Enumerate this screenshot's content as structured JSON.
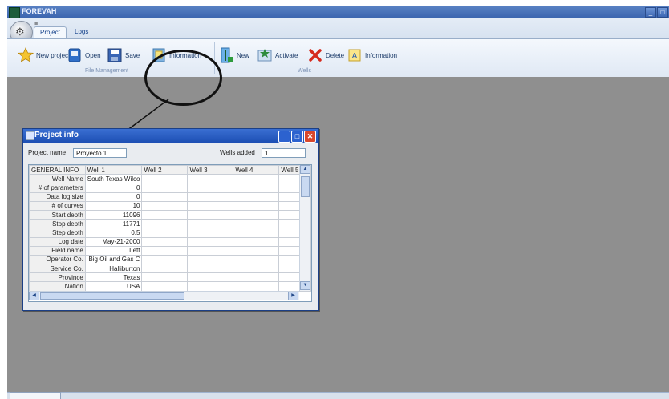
{
  "window": {
    "title": "FOREVAH"
  },
  "ribbon": {
    "quick_access": "≡",
    "tabs": [
      {
        "label": "Project"
      },
      {
        "label": "Logs"
      }
    ],
    "file_management": {
      "label": "File Management",
      "buttons": [
        {
          "label": "New project"
        },
        {
          "label": "Open"
        },
        {
          "label": "Save"
        },
        {
          "label": "Information"
        }
      ]
    },
    "wells": {
      "label": "Wells",
      "buttons": [
        {
          "label": "New"
        },
        {
          "label": "Activate"
        },
        {
          "label": "Delete"
        },
        {
          "label": "Information"
        }
      ]
    }
  },
  "dialog": {
    "title": "Project info",
    "project_name_label": "Project name",
    "project_name_value": "Proyecto 1",
    "wells_added_label": "Wells added",
    "wells_added_value": "1",
    "grid": {
      "columns": [
        "GENERAL INFO",
        "Well 1",
        "Well 2",
        "Well 3",
        "Well 4",
        "Well 5"
      ],
      "rows": [
        {
          "label": "Well Name",
          "value": "South Texas Wilco"
        },
        {
          "label": "# of parameters",
          "value": "0"
        },
        {
          "label": "Data log size",
          "value": "0"
        },
        {
          "label": "# of curves",
          "value": "10"
        },
        {
          "label": "Start depth",
          "value": "11096"
        },
        {
          "label": "Stop depth",
          "value": "11771"
        },
        {
          "label": "Step depth",
          "value": "0.5"
        },
        {
          "label": "Log date",
          "value": "May-21-2000"
        },
        {
          "label": "Field name",
          "value": "Left"
        },
        {
          "label": "Operator Co.",
          "value": "Big Oil and Gas C"
        },
        {
          "label": "Service Co.",
          "value": "Halliburton"
        },
        {
          "label": "Province",
          "value": "Texas"
        },
        {
          "label": "Nation",
          "value": "USA"
        }
      ]
    }
  }
}
